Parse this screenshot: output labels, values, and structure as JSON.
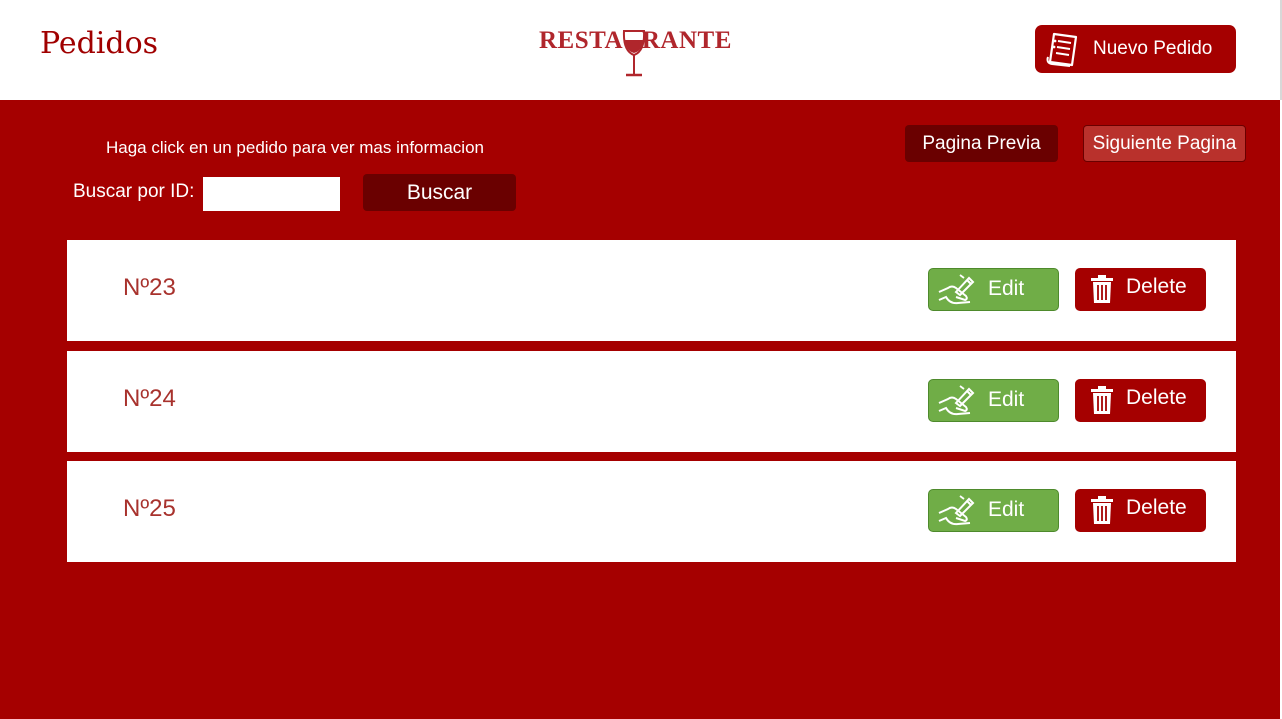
{
  "header": {
    "title": "Pedidos",
    "logo_text": "RESTA   RANTE",
    "new_order_label": "Nuevo Pedido"
  },
  "main": {
    "hint": "Haga click en un pedido para ver mas informacion",
    "search": {
      "label": "Buscar por ID:",
      "value": "",
      "button_label": "Buscar"
    },
    "pagination": {
      "prev_label": "Pagina Previa",
      "next_label": "Siguiente Pagina"
    },
    "orders": [
      {
        "id": "Nº23",
        "edit_label": "Edit",
        "delete_label": "Delete"
      },
      {
        "id": "Nº24",
        "edit_label": "Edit",
        "delete_label": "Delete"
      },
      {
        "id": "Nº25",
        "edit_label": "Edit",
        "delete_label": "Delete"
      }
    ]
  },
  "colors": {
    "primary": "#a50000",
    "dark": "#6a0000",
    "edit": "#70ad47",
    "text_accent": "#a8322d"
  },
  "icons": {
    "new_order": "order-document-icon",
    "logo": "wine-glass-icon",
    "edit": "hand-writing-icon",
    "delete": "trash-icon"
  }
}
